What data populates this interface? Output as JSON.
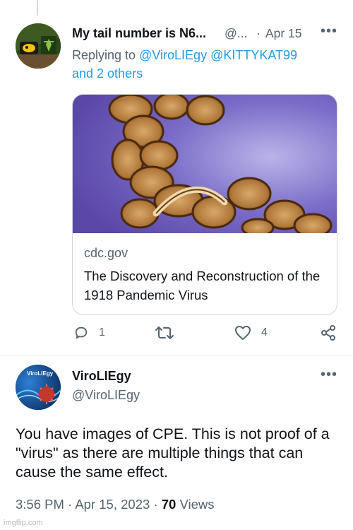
{
  "reply_tweet": {
    "display_name": "My tail number is N6...",
    "handle": "@...",
    "separator": "·",
    "date": "Apr 15",
    "replying_prefix": "Replying to",
    "replying_users": [
      "@ViroLIEgy",
      "@KITTYKAT99"
    ],
    "replying_others": "and 2 others",
    "link_card": {
      "domain": "cdc.gov",
      "title": "The Discovery and Reconstruction of the 1918 Pandemic Virus"
    },
    "actions": {
      "reply_count": "1",
      "retweet_count": "",
      "like_count": "4"
    }
  },
  "main_tweet": {
    "display_name": "ViroLIEgy",
    "handle": "@ViroLIEgy",
    "avatar_text": "ViroLIEgy",
    "text": "You have images of CPE. This is not proof of a \"virus\" as there are multiple things that can cause the same effect.",
    "time": "3:56 PM",
    "separator": "·",
    "date": "Apr 15, 2023",
    "separator2": "·",
    "views_count": "70",
    "views_label": "Views"
  },
  "watermark": "imgflip.com",
  "colors": {
    "accent": "#1d9bf0",
    "muted": "#536471",
    "text": "#0f1419",
    "border": "#cfd9de"
  },
  "icons": [
    "more-icon",
    "reply-icon",
    "retweet-icon",
    "like-icon",
    "share-icon"
  ]
}
